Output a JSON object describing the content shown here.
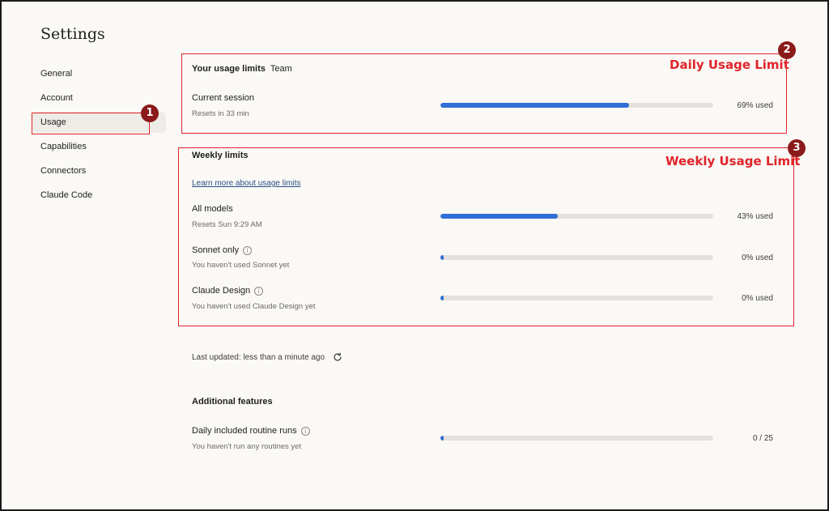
{
  "page_title": "Settings",
  "nav": {
    "items": [
      {
        "label": "General",
        "active": false
      },
      {
        "label": "Account",
        "active": false
      },
      {
        "label": "Usage",
        "active": true
      },
      {
        "label": "Capabilities",
        "active": false
      },
      {
        "label": "Connectors",
        "active": false
      },
      {
        "label": "Claude Code",
        "active": false
      }
    ]
  },
  "usage_limits": {
    "title": "Your usage limits",
    "plan": "Team",
    "current_session": {
      "label": "Current session",
      "sub": "Resets in 33 min",
      "percent": 69,
      "value_label": "69% used"
    }
  },
  "weekly_limits": {
    "title": "Weekly limits",
    "learn_more": "Learn more about usage limits",
    "rows": [
      {
        "label": "All models",
        "sub": "Resets Sun 9:29 AM",
        "percent": 43,
        "value_label": "43% used",
        "info": false
      },
      {
        "label": "Sonnet only",
        "sub": "You haven't used Sonnet yet",
        "percent": 0,
        "value_label": "0% used",
        "info": true
      },
      {
        "label": "Claude Design",
        "sub": "You haven't used Claude Design yet",
        "percent": 0,
        "value_label": "0% used",
        "info": true
      }
    ]
  },
  "last_updated": "Last updated: less than a minute ago",
  "additional_features": {
    "title": "Additional features",
    "routine_runs": {
      "label": "Daily included routine runs",
      "sub": "You haven't run any routines yet",
      "used": 0,
      "total": 25,
      "value_label": "0 / 25"
    }
  },
  "annotations": [
    {
      "number": "1",
      "label": ""
    },
    {
      "number": "2",
      "label": "Daily Usage Limit"
    },
    {
      "number": "3",
      "label": "Weekly Usage Limit"
    }
  ],
  "icons": {
    "info": "info-icon",
    "refresh": "refresh-icon"
  },
  "colors": {
    "accent_bar": "#2f6fd6",
    "annotation_red": "#e0242a",
    "badge_dark_red": "#8b1a1a",
    "background": "#faf9f5"
  }
}
